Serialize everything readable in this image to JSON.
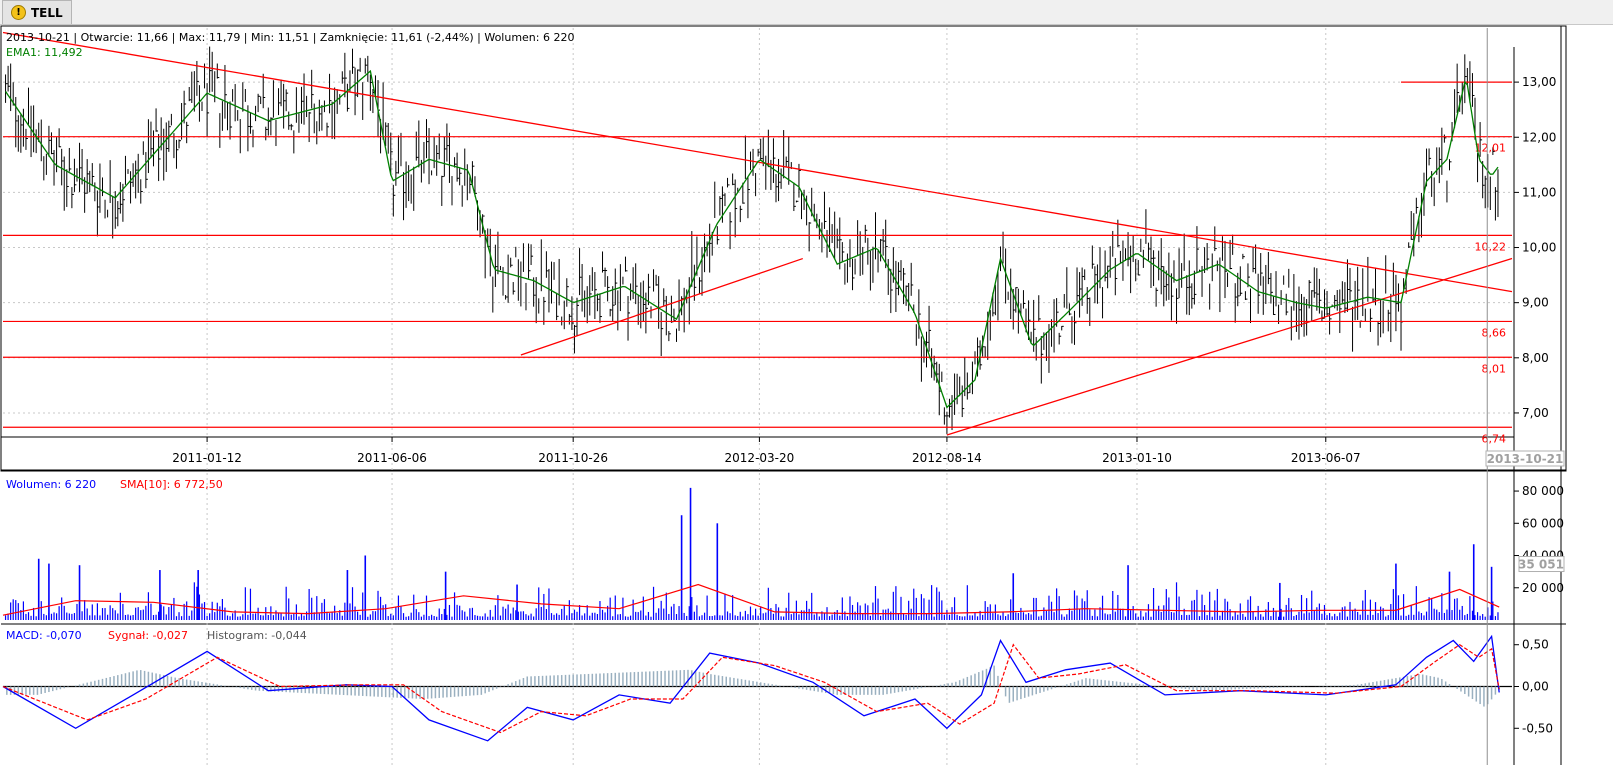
{
  "tab": {
    "icon": "warning-icon",
    "label": "TELL"
  },
  "price_info": {
    "date": "2013-10-21",
    "open": "Otwarcie: 11,66",
    "max": "Max: 11,79",
    "min": "Min: 11,51",
    "close": "Zamknięcie: 11,61 (-2,44%)",
    "volume": "Wolumen: 6 220"
  },
  "ema_label": "EMA1: 11,492",
  "volume_info": {
    "volume": "Wolumen: 6 220",
    "sma": "SMA[10]: 6 772,50"
  },
  "macd_info": {
    "macd": "MACD: -0,070",
    "signal": "Sygnał: -0,027",
    "histogram": "Histogram: -0,044"
  },
  "current_date_label": "2013-10-21",
  "volume_marker_label": "35 051",
  "colors": {
    "candle": "#000000",
    "ema": "#008000",
    "level": "#ff0000",
    "volume": "#0000ff",
    "sma": "#ff0000",
    "macd": "#0000ff",
    "signal": "#ff0000",
    "histogram": "#9ab0c0",
    "grid": "#c8c8c8"
  },
  "chart_data": [
    {
      "type": "line",
      "panel": "price",
      "x_ticks": [
        "2011-01-12",
        "2011-06-06",
        "2011-10-26",
        "2012-03-20",
        "2012-08-14",
        "2013-01-10",
        "2013-06-07"
      ],
      "y_ticks": [
        "7,00",
        "8,00",
        "9,00",
        "10,00",
        "11,00",
        "12,00",
        "13,00"
      ],
      "ylim": [
        6.6,
        13.8
      ],
      "horizontal_levels": [
        {
          "value": 12.01,
          "label": "12,01"
        },
        {
          "value": 10.22,
          "label": "10,22"
        },
        {
          "value": 8.66,
          "label": "8,66"
        },
        {
          "value": 8.01,
          "label": "8,01"
        },
        {
          "value": 6.74,
          "label": "6,74"
        }
      ],
      "short_level": 13.0,
      "trend_lines": [
        {
          "from": [
            "2010-08-05",
            13.9
          ],
          "to": [
            "2013-10-31",
            9.2
          ]
        },
        {
          "from": [
            "2011-09-15",
            8.05
          ],
          "to": [
            "2012-04-23",
            9.8
          ]
        },
        {
          "from": [
            "2012-08-14",
            6.6
          ],
          "to": [
            "2013-10-31",
            9.8
          ]
        }
      ],
      "series": [
        {
          "name": "EMA1",
          "x": [
            "2010-08-05",
            "2010-09-15",
            "2010-11-01",
            "2011-01-12",
            "2011-03-01",
            "2011-04-20",
            "2011-05-20",
            "2011-06-06",
            "2011-07-05",
            "2011-08-05",
            "2011-08-25",
            "2011-09-25",
            "2011-10-26",
            "2011-12-05",
            "2012-01-15",
            "2012-02-15",
            "2012-03-20",
            "2012-04-20",
            "2012-05-20",
            "2012-06-20",
            "2012-07-20",
            "2012-08-14",
            "2012-09-05",
            "2012-09-25",
            "2012-10-20",
            "2012-11-20",
            "2012-12-20",
            "2013-01-10",
            "2013-02-10",
            "2013-03-15",
            "2013-04-15",
            "2013-05-15",
            "2013-06-07",
            "2013-07-10",
            "2013-08-05",
            "2013-08-25",
            "2013-09-10",
            "2013-09-25",
            "2013-10-05",
            "2013-10-15",
            "2013-10-21"
          ],
          "values": [
            12.9,
            11.5,
            10.9,
            12.8,
            12.3,
            12.6,
            13.2,
            11.2,
            11.6,
            11.4,
            9.6,
            9.4,
            9.0,
            9.3,
            8.7,
            10.4,
            11.6,
            11.1,
            9.7,
            10.0,
            8.8,
            7.1,
            7.6,
            9.8,
            8.2,
            8.9,
            9.6,
            9.9,
            9.4,
            9.7,
            9.2,
            9.0,
            8.9,
            9.1,
            9.0,
            11.2,
            11.6,
            13.1,
            11.6,
            11.3,
            11.49
          ]
        }
      ]
    },
    {
      "type": "bar",
      "panel": "volume",
      "y_ticks": [
        "20 000",
        "40 000",
        "60 000",
        "80 000"
      ],
      "ylim": [
        0,
        85000
      ],
      "series": [
        {
          "name": "Wolumen",
          "x": [
            "2010-09-02",
            "2010-09-10",
            "2010-10-04",
            "2010-12-06",
            "2011-01-05",
            "2011-05-02",
            "2011-05-16",
            "2011-07-18",
            "2011-09-12",
            "2012-01-19",
            "2012-01-26",
            "2012-02-16",
            "2012-10-05",
            "2013-01-03",
            "2013-05-02",
            "2013-08-01",
            "2013-09-12",
            "2013-10-01",
            "2013-10-15"
          ],
          "values": [
            38000,
            35000,
            34000,
            31000,
            31000,
            31000,
            40000,
            30000,
            22000,
            65000,
            82000,
            60000,
            29000,
            34000,
            23000,
            35000,
            30000,
            47000,
            33000
          ]
        },
        {
          "name": "SMA[10]",
          "x": [
            "2010-08-05",
            "2010-10-01",
            "2010-12-01",
            "2011-02-01",
            "2011-04-01",
            "2011-06-01",
            "2011-08-01",
            "2011-10-01",
            "2011-12-01",
            "2012-02-01",
            "2012-04-01",
            "2012-06-01",
            "2012-08-01",
            "2012-10-01",
            "2012-12-01",
            "2013-02-01",
            "2013-04-01",
            "2013-06-01",
            "2013-08-01",
            "2013-09-20",
            "2013-10-21"
          ],
          "values": [
            3000,
            12000,
            11000,
            5000,
            4000,
            7000,
            15000,
            10000,
            7000,
            22000,
            5000,
            4000,
            4000,
            5000,
            7000,
            6000,
            5000,
            6000,
            6000,
            19000,
            8000
          ]
        }
      ]
    },
    {
      "type": "line",
      "panel": "macd",
      "y_ticks": [
        "-0,50",
        "0,00",
        "0,50"
      ],
      "ylim": [
        -0.7,
        0.7
      ],
      "series": [
        {
          "name": "MACD",
          "x": [
            "2010-08-05",
            "2010-10-01",
            "2010-11-15",
            "2011-01-12",
            "2011-03-01",
            "2011-05-01",
            "2011-06-06",
            "2011-07-05",
            "2011-08-20",
            "2011-09-20",
            "2011-10-26",
            "2011-12-01",
            "2012-01-10",
            "2012-02-10",
            "2012-03-20",
            "2012-05-01",
            "2012-06-10",
            "2012-07-20",
            "2012-08-14",
            "2012-09-10",
            "2012-09-25",
            "2012-10-15",
            "2012-11-15",
            "2012-12-20",
            "2013-02-01",
            "2013-04-01",
            "2013-06-07",
            "2013-08-01",
            "2013-08-25",
            "2013-09-15",
            "2013-10-01",
            "2013-10-15",
            "2013-10-21"
          ],
          "values": [
            0.0,
            -0.5,
            -0.1,
            0.42,
            -0.05,
            0.02,
            0.0,
            -0.4,
            -0.65,
            -0.25,
            -0.4,
            -0.1,
            -0.2,
            0.4,
            0.28,
            0.05,
            -0.35,
            -0.15,
            -0.5,
            -0.1,
            0.55,
            0.05,
            0.2,
            0.28,
            -0.1,
            -0.05,
            -0.1,
            0.02,
            0.35,
            0.55,
            0.3,
            0.6,
            -0.07
          ]
        },
        {
          "name": "Sygnał",
          "x": [
            "2010-08-05",
            "2010-10-10",
            "2010-11-25",
            "2011-01-20",
            "2011-03-10",
            "2011-05-10",
            "2011-06-15",
            "2011-07-15",
            "2011-08-30",
            "2011-10-01",
            "2011-11-05",
            "2011-12-10",
            "2012-01-20",
            "2012-02-20",
            "2012-04-01",
            "2012-05-10",
            "2012-06-20",
            "2012-07-30",
            "2012-08-24",
            "2012-09-20",
            "2012-10-05",
            "2012-10-25",
            "2012-11-25",
            "2013-01-01",
            "2013-02-10",
            "2013-04-10",
            "2013-06-15",
            "2013-08-05",
            "2013-09-01",
            "2013-09-20",
            "2013-10-05",
            "2013-10-15",
            "2013-10-21"
          ],
          "values": [
            0.0,
            -0.4,
            -0.15,
            0.35,
            0.0,
            0.02,
            0.02,
            -0.3,
            -0.55,
            -0.3,
            -0.35,
            -0.15,
            -0.15,
            0.35,
            0.25,
            0.05,
            -0.3,
            -0.2,
            -0.45,
            -0.2,
            0.5,
            0.1,
            0.15,
            0.26,
            -0.05,
            -0.05,
            -0.08,
            0.0,
            0.3,
            0.5,
            0.35,
            0.45,
            -0.03
          ]
        },
        {
          "name": "Histogram",
          "x": [
            "2010-09-01",
            "2010-11-20",
            "2010-12-20",
            "2011-02-20",
            "2011-07-01",
            "2011-08-15",
            "2011-09-20",
            "2012-01-25",
            "2012-02-10",
            "2012-05-20",
            "2012-06-25",
            "2012-08-20",
            "2012-09-20",
            "2012-10-01",
            "2012-12-01",
            "2013-03-01",
            "2013-07-01",
            "2013-08-20",
            "2013-09-05",
            "2013-10-10",
            "2013-10-21"
          ],
          "values": [
            -0.1,
            0.2,
            0.1,
            -0.05,
            -0.15,
            -0.1,
            0.12,
            0.2,
            0.15,
            -0.1,
            -0.1,
            0.05,
            0.25,
            -0.2,
            0.1,
            -0.05,
            0.02,
            0.15,
            0.1,
            -0.25,
            -0.04
          ]
        }
      ]
    }
  ]
}
